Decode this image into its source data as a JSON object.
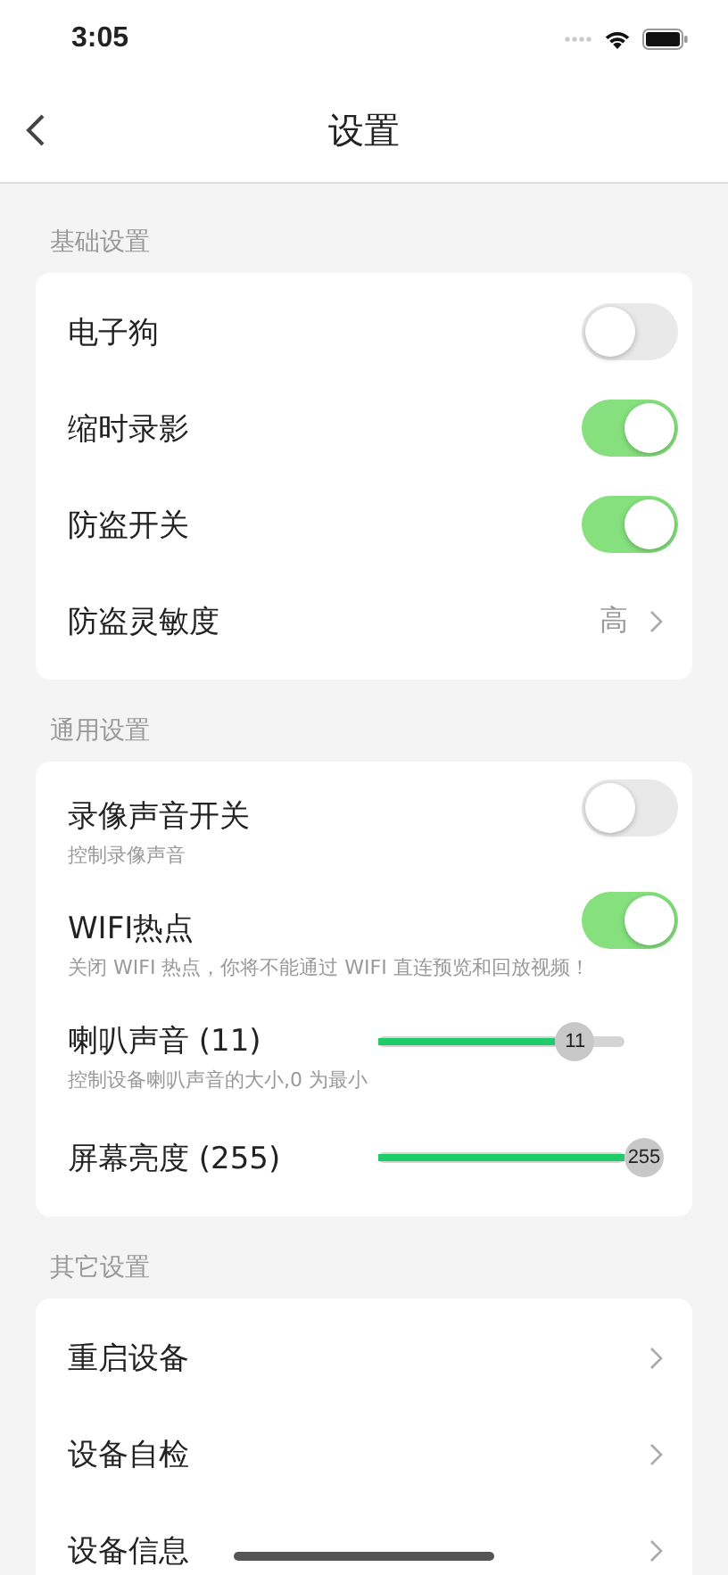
{
  "status_bar": {
    "time": "3:05"
  },
  "nav": {
    "title": "设置"
  },
  "sections": [
    {
      "header": "基础设置",
      "rows": [
        {
          "kind": "switch",
          "label": "电子狗",
          "on": false
        },
        {
          "kind": "switch",
          "label": "缩时录影",
          "on": true
        },
        {
          "kind": "switch",
          "label": "防盗开关",
          "on": true
        },
        {
          "kind": "choice",
          "label": "防盗灵敏度",
          "value": "高"
        }
      ]
    },
    {
      "header": "通用设置",
      "rows": [
        {
          "kind": "switch",
          "label": "录像声音开关",
          "on": false,
          "hint": "控制录像声音"
        },
        {
          "kind": "switch",
          "label": "WIFI热点",
          "on": true,
          "hint": "关闭 WIFI 热点，你将不能通过 WIFI 直连预览和回放视频！"
        },
        {
          "kind": "slider",
          "label": "喇叭声音 (11)",
          "level": 0.72,
          "reading": "11",
          "hint": "控制设备喇叭声音的大小,0 为最小"
        },
        {
          "kind": "slider",
          "label": "屏幕亮度 (255)",
          "level": 1,
          "reading": "255"
        }
      ]
    },
    {
      "header": "其它设置",
      "rows": [
        {
          "kind": "link",
          "label": "重启设备"
        },
        {
          "kind": "link",
          "label": "设备自检"
        },
        {
          "kind": "link",
          "label": "设备信息"
        }
      ]
    }
  ]
}
